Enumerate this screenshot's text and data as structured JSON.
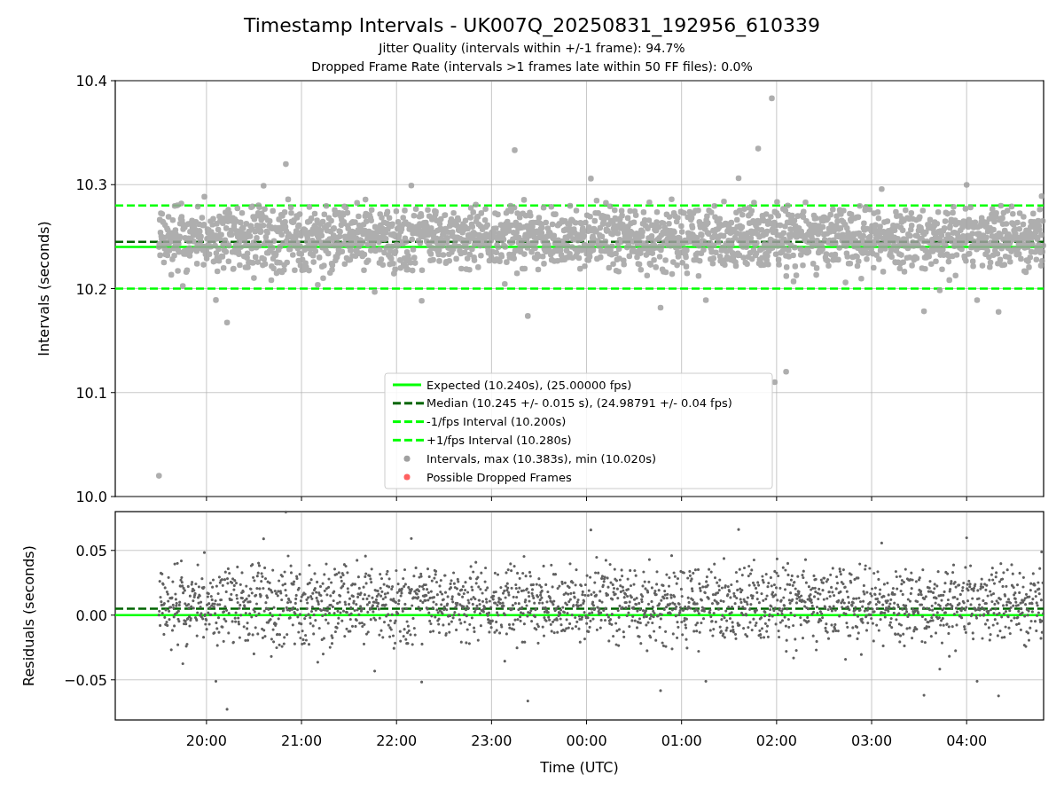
{
  "title": "Timestamp Intervals - UK007Q_20250831_192956_610339",
  "subtitles": [
    "Jitter Quality (intervals within +/-1 frame): 94.7%",
    "Dropped Frame Rate (intervals >1 frames late within 50 FF files): 0.0%"
  ],
  "interval_plot": {
    "ylabel": "Intervals (seconds)",
    "yticks": [
      "10.4",
      "10.3",
      "10.2",
      "10.1",
      "10.0"
    ],
    "legend": [
      {
        "label": "Expected (10.240s), (25.00000 fps)",
        "kind": "line",
        "color": "#00ff00"
      },
      {
        "label": "Median (10.245 +/- 0.015 s), (24.98791 +/- 0.04 fps)",
        "kind": "dashed",
        "color": "#006400"
      },
      {
        "label": "-1/fps Interval (10.200s)",
        "kind": "dashed",
        "color": "#00ff00"
      },
      {
        "label": "+1/fps Interval (10.280s)",
        "kind": "dashed",
        "color": "#00ff00"
      },
      {
        "label": "Intervals, max (10.383s), min (10.020s)",
        "kind": "dot",
        "color": "#a0a0a0"
      },
      {
        "label": "Possible Dropped Frames",
        "kind": "dot",
        "color": "#ff6060"
      }
    ]
  },
  "residual_plot": {
    "ylabel": "Residuals (seconds)",
    "yticks": [
      "0.05",
      "0.00",
      "−0.05"
    ],
    "xticks": [
      "20:00",
      "21:00",
      "22:00",
      "23:00",
      "00:00",
      "01:00",
      "02:00",
      "03:00",
      "04:00"
    ],
    "xlabel": "Time (UTC)"
  }
}
